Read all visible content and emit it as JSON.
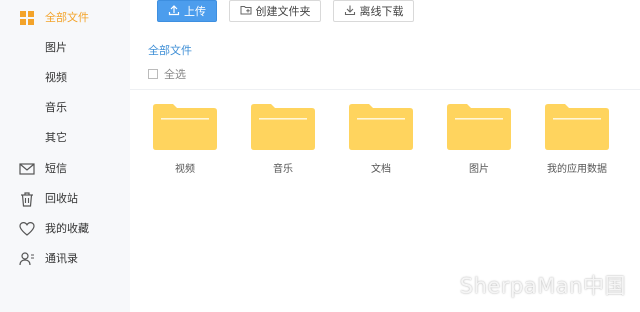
{
  "sidebar": {
    "items": [
      {
        "label": "全部文件",
        "icon": "grid-icon",
        "active": true
      },
      {
        "label": "图片"
      },
      {
        "label": "视频"
      },
      {
        "label": "音乐"
      },
      {
        "label": "其它"
      },
      {
        "label": "短信",
        "icon": "mail-icon"
      },
      {
        "label": "回收站",
        "icon": "trash-icon"
      },
      {
        "label": "我的收藏",
        "icon": "heart-icon"
      },
      {
        "label": "通讯录",
        "icon": "contacts-icon"
      }
    ],
    "active_color": "#f3a32a"
  },
  "toolbar": {
    "upload_label": "上传",
    "new_folder_label": "创建文件夹",
    "offline_download_label": "离线下载"
  },
  "breadcrumb": {
    "label": "全部文件"
  },
  "select_all": {
    "label": "全选",
    "checked": false
  },
  "folders": [
    {
      "name": "视频"
    },
    {
      "name": "音乐"
    },
    {
      "name": "文档"
    },
    {
      "name": "图片"
    },
    {
      "name": "我的应用数据"
    }
  ],
  "watermark": "SherpaMan中国",
  "colors": {
    "folder": "#ffd45e",
    "primary_button": "#4c9ded",
    "link": "#3f8fd6"
  }
}
